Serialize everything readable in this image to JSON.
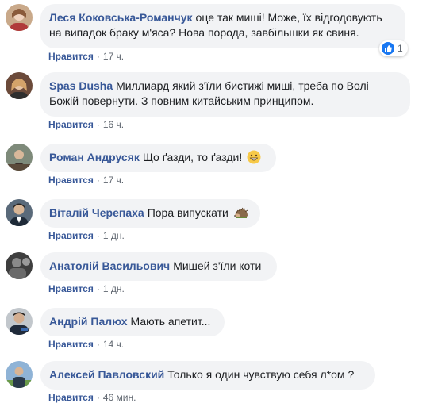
{
  "comments": [
    {
      "author": "Леся Коковська-Романчук",
      "text_line1": "оце так миші! Може, їх відгодовують",
      "text_line2": "на випадок браку м'яса? Нова порода, завбільшки як свиня.",
      "like": "Нравится",
      "time": "17 ч.",
      "reaction_count": "1",
      "reaction_icon": "thumbs-up-icon"
    },
    {
      "author": "Spas Dusha",
      "text_line1": "Миллиард який з'їли бистижі миші, треба по Волі",
      "text_line2": "Божій повернути. З повним китайським принципом.",
      "like": "Нравится",
      "time": "16 ч."
    },
    {
      "author": "Роман Андрусяк",
      "text": "Що ґазди, то ґазди!",
      "emoji": "grin-emoji-icon",
      "like": "Нравится",
      "time": "17 ч."
    },
    {
      "author": "Віталій Черепаха",
      "text": "Пора випускати",
      "emoji": "hedgehog-emoji-icon",
      "like": "Нравится",
      "time": "1 дн."
    },
    {
      "author": "Анатолій Васильович",
      "text": "Мишей з'їли коти",
      "like": "Нравится",
      "time": "1 дн."
    },
    {
      "author": "Андрій Палюх",
      "text": "Мають апетит...",
      "like": "Нравится",
      "time": "14 ч."
    },
    {
      "author": "Алексей Павловский",
      "text": "Только я один чувствую себя л*ом ?",
      "like": "Нравится",
      "time": "46 мин."
    }
  ],
  "separator": "·",
  "colors": {
    "link": "#385898",
    "bubble": "#f2f3f5",
    "meta": "#606770",
    "like_blue": "#1877f2"
  }
}
